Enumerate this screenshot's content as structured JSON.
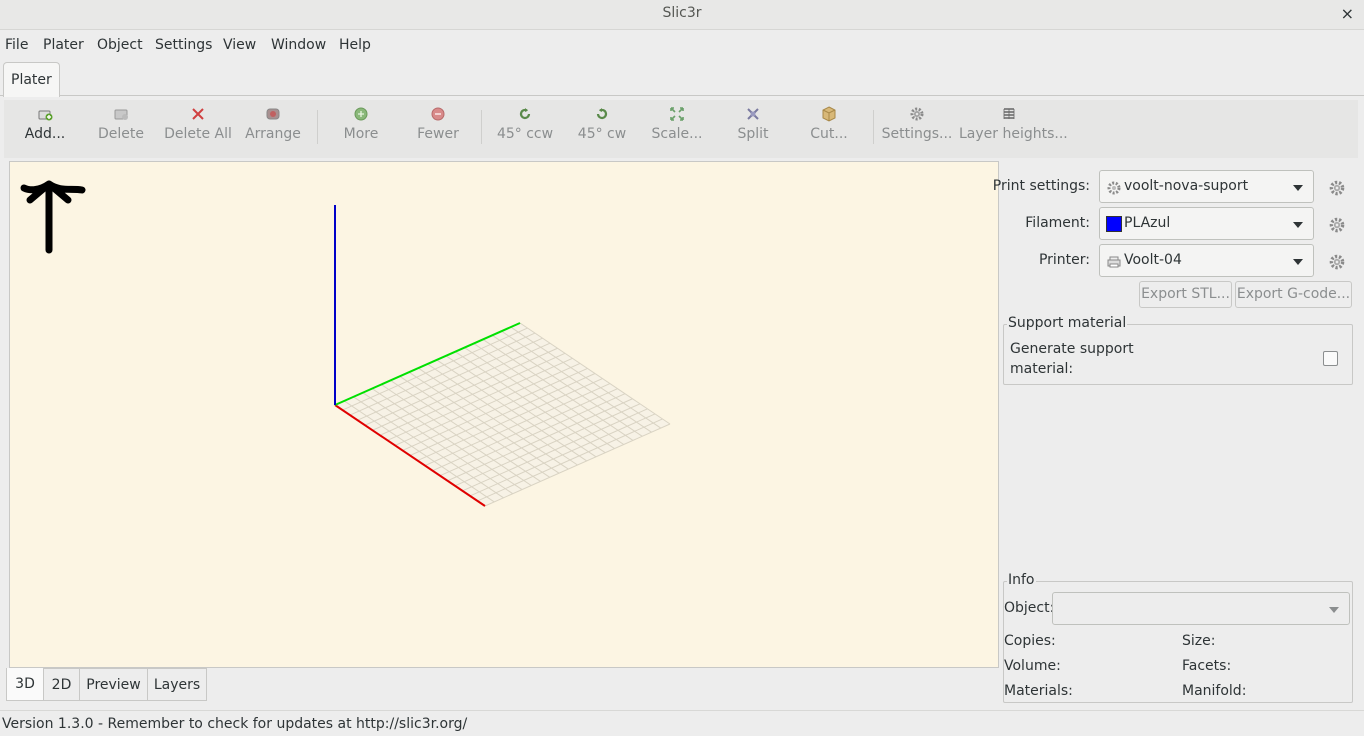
{
  "window": {
    "title": "Slic3r",
    "close_glyph": "×"
  },
  "menubar": {
    "items": [
      "File",
      "Plater",
      "Object",
      "Settings",
      "View",
      "Window",
      "Help"
    ]
  },
  "tabs": {
    "plater": "Plater"
  },
  "toolbar": {
    "add": "Add...",
    "delete": "Delete",
    "delete_all": "Delete All",
    "arrange": "Arrange",
    "more": "More",
    "fewer": "Fewer",
    "rotate_ccw": "45° ccw",
    "rotate_cw": "45° cw",
    "scale": "Scale...",
    "split": "Split",
    "cut": "Cut...",
    "settings": "Settings...",
    "layer_heights": "Layer heights..."
  },
  "view_tabs": [
    "3D",
    "2D",
    "Preview",
    "Layers"
  ],
  "right_panel": {
    "print_settings_label": "Print settings:",
    "print_settings_value": "voolt-nova-suport",
    "filament_label": "Filament:",
    "filament_value": "PLAzul",
    "filament_color": "#0000ff",
    "printer_label": "Printer:",
    "printer_value": "Voolt-04",
    "export_stl": "Export STL...",
    "export_gcode": "Export G-code...",
    "support_group": "Support material",
    "generate_support_line1": "Generate support",
    "generate_support_line2": "material:",
    "generate_support_checked": false,
    "info_group": "Info",
    "object_label": "Object:",
    "object_value": "",
    "copies": "Copies:",
    "size": "Size:",
    "volume": "Volume:",
    "facets": "Facets:",
    "materials": "Materials:",
    "manifold": "Manifold:"
  },
  "status": {
    "text": "Version 1.3.0 - Remember to check for updates at http://slic3r.org/"
  },
  "colors": {
    "canvas_bg": "#fcf5e3",
    "axis_x": "#e00000",
    "axis_y": "#00e000",
    "axis_z": "#0000c8",
    "bed_grid": "#d9d3c3"
  }
}
